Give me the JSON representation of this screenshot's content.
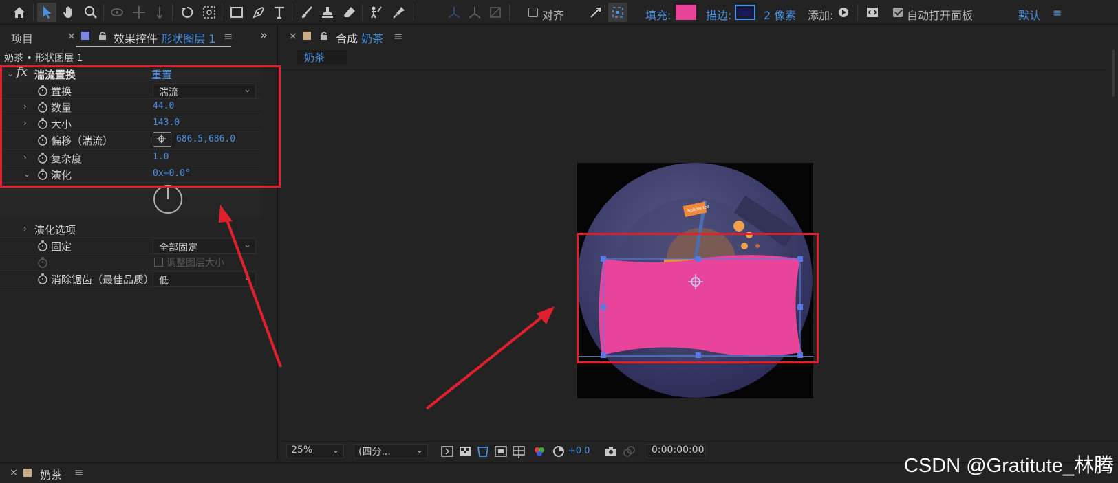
{
  "toolbar": {
    "align_label": "对齐",
    "fill_label": "填充:",
    "stroke_label": "描边:",
    "stroke_width": "2 像素",
    "add_label": "添加:",
    "auto_open_label": "自动打开面板",
    "workspace": "默认",
    "fill_color": "#e8449a",
    "stroke_color": "#1a1a5a"
  },
  "left_panel": {
    "tab_project": "项目",
    "tab_effects_prefix": "效果控件",
    "tab_effects_layer": "形状图层 1",
    "layer_title": "奶茶 • 形状图层 1",
    "effect": {
      "name": "湍流置换",
      "reset": "重置",
      "properties": [
        {
          "label": "置换",
          "type": "dropdown",
          "value": "湍流"
        },
        {
          "label": "数量",
          "type": "number",
          "value": "44.0"
        },
        {
          "label": "大小",
          "type": "number",
          "value": "143.0"
        },
        {
          "label": "偏移（湍流）",
          "type": "point",
          "value": "686.5,686.0"
        },
        {
          "label": "复杂度",
          "type": "number",
          "value": "1.0"
        },
        {
          "label": "演化",
          "type": "angle",
          "value": "0x+0.0°"
        }
      ],
      "evolution_options": "演化选项",
      "pinning_label": "固定",
      "pinning_value": "全部固定",
      "resize_layer_label": "调整图层大小",
      "antialias_label": "消除锯齿（最佳品质）",
      "antialias_value": "低"
    }
  },
  "comp_panel": {
    "tab_prefix": "合成",
    "tab_name": "奶茶",
    "breadcrumb": "奶茶",
    "flag_text": "Bubble tea",
    "zoom": "25%",
    "resolution": "(四分...",
    "exposure": "+0.0",
    "timecode": "0:00:00:00"
  },
  "bottom_panel": {
    "tab_name": "奶茶"
  },
  "watermark": "CSDN @Gratitute_林腾"
}
